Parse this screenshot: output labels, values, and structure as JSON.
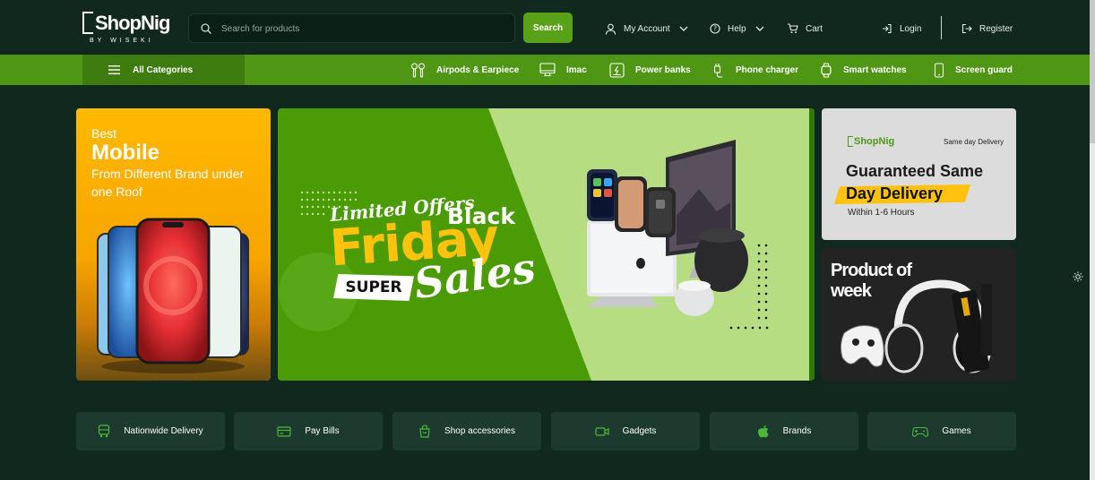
{
  "header": {
    "logo": {
      "name": "ShopNig",
      "by": "BY WISEKI"
    },
    "search": {
      "placeholder": "Search for products",
      "button_label": "Search"
    },
    "nav": {
      "account": "My Account",
      "help": "Help",
      "cart": "Cart",
      "login": "Login",
      "register": "Register"
    }
  },
  "category_bar": {
    "all_label": "All Categories",
    "items": [
      {
        "label": "Airpods & Earpiece",
        "icon": "airpods-icon"
      },
      {
        "label": "Imac",
        "icon": "monitor-icon"
      },
      {
        "label": "Power banks",
        "icon": "battery-icon"
      },
      {
        "label": "Phone charger",
        "icon": "charger-icon"
      },
      {
        "label": "Smart watches",
        "icon": "watch-icon"
      },
      {
        "label": "Screen guard",
        "icon": "phone-icon"
      }
    ]
  },
  "banners": {
    "mobile": {
      "line1": "Best",
      "line2": "Mobile",
      "line3": "From Different Brand under one Roof"
    },
    "black_friday": {
      "limited": "Limited Offers",
      "black": "Black",
      "friday": "Friday",
      "super": "SUPER",
      "sales": "Sales"
    },
    "delivery": {
      "logo": "ShopNig",
      "tag": "Same day Delivery",
      "line1": "Guaranteed Same",
      "line2": "Day Delivery",
      "line3": "Within 1-6 Hours"
    },
    "product_of_week": {
      "line1": "Product of",
      "line2": "week"
    }
  },
  "features": [
    {
      "label": "Nationwide Delivery",
      "icon": "truck-icon"
    },
    {
      "label": "Pay Bills",
      "icon": "card-icon"
    },
    {
      "label": "Shop accessories",
      "icon": "bag-icon"
    },
    {
      "label": "Gadgets",
      "icon": "camera-icon"
    },
    {
      "label": "Brands",
      "icon": "apple-icon"
    },
    {
      "label": "Games",
      "icon": "gamepad-icon"
    }
  ],
  "colors": {
    "background": "#10281e",
    "accent": "#4f9614",
    "accent_dark": "#3f7c10",
    "feature_bg": "#1c3b2e",
    "yellow": "#ffc20e"
  }
}
